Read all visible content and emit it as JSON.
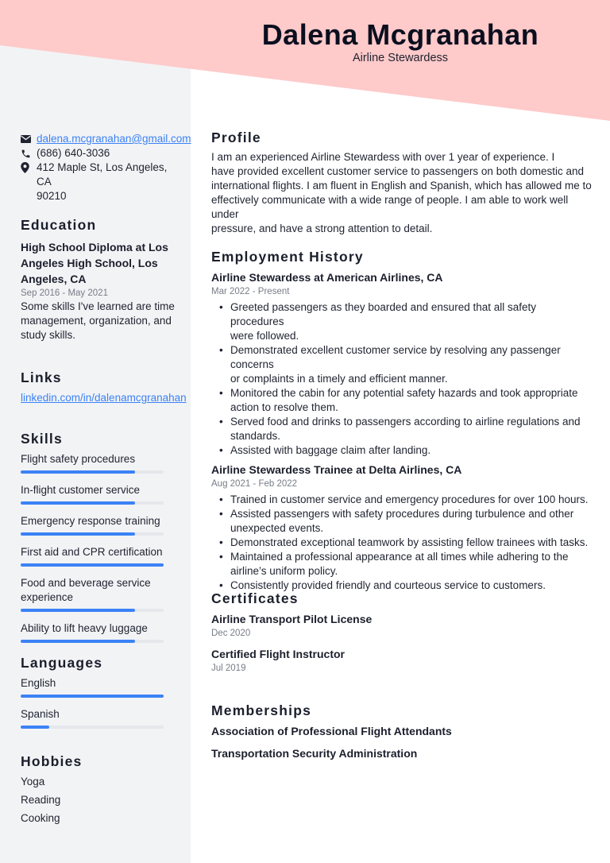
{
  "header": {
    "name": "Dalena Mcgranahan",
    "title": "Airline Stewardess"
  },
  "colors": {
    "header_accent": "#fecaca",
    "sidebar_bg": "#f2f3f5",
    "link": "#3b82f6",
    "bar_fill": "#3b82f6",
    "bar_track": "#e5e7eb"
  },
  "contact": {
    "email": "dalena.mcgranahan@gmail.com",
    "phone": "(686) 640-3036",
    "address_line1": "412 Maple St, Los Angeles, CA",
    "address_line2": "90210",
    "icons": [
      "envelope-icon",
      "phone-icon",
      "map-pin-icon"
    ]
  },
  "education": {
    "heading": "Education",
    "items": [
      {
        "title_lines": [
          "High School Diploma at Los",
          "Angeles High School, Los",
          "Angeles, CA"
        ],
        "dates": "Sep 2016 - May 2021",
        "description_lines": [
          "Some skills I've learned are time",
          "management, organization, and",
          "study skills."
        ]
      }
    ]
  },
  "links": {
    "heading": "Links",
    "items": [
      {
        "label": "linkedin.com/in/dalenamcgranahan"
      }
    ]
  },
  "skills": {
    "heading": "Skills",
    "items": [
      {
        "label": "Flight safety procedures",
        "level": 0.8
      },
      {
        "label": "In-flight customer service",
        "level": 0.8
      },
      {
        "label": "Emergency response training",
        "level": 0.8
      },
      {
        "label": "First aid and CPR certification",
        "level": 1.0
      },
      {
        "label": "Food and beverage service experience",
        "level": 0.8
      },
      {
        "label": "Ability to lift heavy luggage",
        "level": 0.8
      }
    ]
  },
  "languages": {
    "heading": "Languages",
    "items": [
      {
        "label": "English",
        "level": 1.0
      },
      {
        "label": "Spanish",
        "level": 0.2
      }
    ]
  },
  "hobbies": {
    "heading": "Hobbies",
    "items": [
      "Yoga",
      "Reading",
      "Cooking"
    ]
  },
  "profile": {
    "heading": "Profile",
    "lines": [
      "I am an experienced Airline Stewardess with over 1 year of experience. I",
      "have provided excellent customer service to passengers on both domestic and",
      "international flights. I am fluent in English and Spanish, which has allowed me to",
      "effectively communicate with a wide range of people. I am able to work well under",
      "pressure, and have a strong attention to detail."
    ]
  },
  "employment": {
    "heading": "Employment History",
    "jobs": [
      {
        "title": "Airline Stewardess at American Airlines, CA",
        "dates": "Mar 2022 - Present",
        "bullets": [
          [
            "Greeted passengers as they boarded and ensured that all safety procedures",
            "were followed."
          ],
          [
            "Demonstrated excellent customer service by resolving any passenger concerns",
            "or complaints in a timely and efficient manner."
          ],
          [
            "Monitored the cabin for any potential safety hazards and took appropriate",
            "action to resolve them."
          ],
          [
            "Served food and drinks to passengers according to airline regulations and",
            "standards."
          ],
          [
            "Assisted with baggage claim after landing."
          ]
        ]
      },
      {
        "title": "Airline Stewardess Trainee at Delta Airlines, CA",
        "dates": "Aug 2021 - Feb 2022",
        "bullets": [
          [
            "Trained in customer service and emergency procedures for over 100 hours."
          ],
          [
            "Assisted passengers with safety procedures during turbulence and other",
            "unexpected events."
          ],
          [
            "Demonstrated exceptional teamwork by assisting fellow trainees with tasks."
          ],
          [
            "Maintained a professional appearance at all times while adhering to the",
            "airline’s uniform policy."
          ],
          [
            "Consistently provided friendly and courteous service to customers."
          ]
        ]
      }
    ]
  },
  "certificates": {
    "heading": "Certificates",
    "items": [
      {
        "title": "Airline Transport Pilot License",
        "date": "Dec 2020"
      },
      {
        "title": "Certified Flight Instructor",
        "date": "Jul 2019"
      }
    ]
  },
  "memberships": {
    "heading": "Memberships",
    "items": [
      "Association of Professional Flight Attendants",
      "Transportation Security Administration"
    ]
  }
}
